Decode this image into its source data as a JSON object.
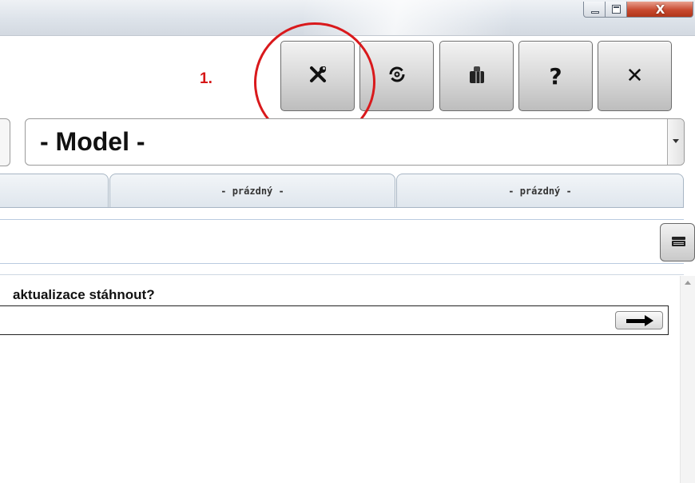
{
  "window": {
    "minimize_glyph": "—",
    "maximize_glyph": "□",
    "close_glyph": "X"
  },
  "toolbar": {
    "annotation": "1.",
    "buttons": [
      {
        "name": "settings",
        "icon": "tools-icon",
        "glyph": "✖"
      },
      {
        "name": "update",
        "icon": "update-icon",
        "glyph": "⊛"
      },
      {
        "name": "packages",
        "icon": "box-icon",
        "glyph": "▮"
      },
      {
        "name": "help",
        "icon": "question-icon",
        "glyph": "?"
      },
      {
        "name": "close",
        "icon": "close-icon",
        "glyph": "✕"
      }
    ]
  },
  "model_select": {
    "value": "- Model -"
  },
  "tabs": [
    {
      "label": ""
    },
    {
      "label": "- prázdný -"
    },
    {
      "label": "- prázdný -"
    }
  ],
  "content": {
    "question": "aktualizace stáhnout?"
  },
  "colors": {
    "annotation_red": "#d61616",
    "title_close_red": "#c84a30",
    "tab_bg": "#dfe6ed"
  }
}
